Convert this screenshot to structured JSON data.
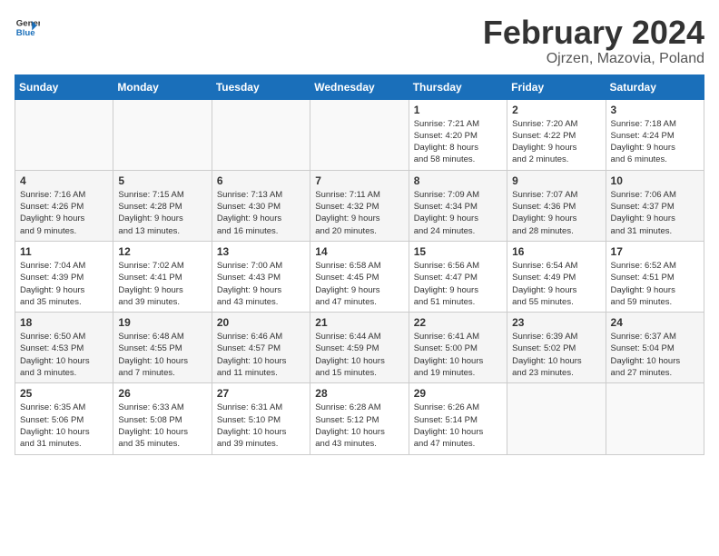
{
  "header": {
    "logo_line1": "General",
    "logo_line2": "Blue",
    "main_title": "February 2024",
    "subtitle": "Ojrzen, Mazovia, Poland"
  },
  "columns": [
    "Sunday",
    "Monday",
    "Tuesday",
    "Wednesday",
    "Thursday",
    "Friday",
    "Saturday"
  ],
  "weeks": [
    [
      {
        "day": "",
        "info": ""
      },
      {
        "day": "",
        "info": ""
      },
      {
        "day": "",
        "info": ""
      },
      {
        "day": "",
        "info": ""
      },
      {
        "day": "1",
        "info": "Sunrise: 7:21 AM\nSunset: 4:20 PM\nDaylight: 8 hours\nand 58 minutes."
      },
      {
        "day": "2",
        "info": "Sunrise: 7:20 AM\nSunset: 4:22 PM\nDaylight: 9 hours\nand 2 minutes."
      },
      {
        "day": "3",
        "info": "Sunrise: 7:18 AM\nSunset: 4:24 PM\nDaylight: 9 hours\nand 6 minutes."
      }
    ],
    [
      {
        "day": "4",
        "info": "Sunrise: 7:16 AM\nSunset: 4:26 PM\nDaylight: 9 hours\nand 9 minutes."
      },
      {
        "day": "5",
        "info": "Sunrise: 7:15 AM\nSunset: 4:28 PM\nDaylight: 9 hours\nand 13 minutes."
      },
      {
        "day": "6",
        "info": "Sunrise: 7:13 AM\nSunset: 4:30 PM\nDaylight: 9 hours\nand 16 minutes."
      },
      {
        "day": "7",
        "info": "Sunrise: 7:11 AM\nSunset: 4:32 PM\nDaylight: 9 hours\nand 20 minutes."
      },
      {
        "day": "8",
        "info": "Sunrise: 7:09 AM\nSunset: 4:34 PM\nDaylight: 9 hours\nand 24 minutes."
      },
      {
        "day": "9",
        "info": "Sunrise: 7:07 AM\nSunset: 4:36 PM\nDaylight: 9 hours\nand 28 minutes."
      },
      {
        "day": "10",
        "info": "Sunrise: 7:06 AM\nSunset: 4:37 PM\nDaylight: 9 hours\nand 31 minutes."
      }
    ],
    [
      {
        "day": "11",
        "info": "Sunrise: 7:04 AM\nSunset: 4:39 PM\nDaylight: 9 hours\nand 35 minutes."
      },
      {
        "day": "12",
        "info": "Sunrise: 7:02 AM\nSunset: 4:41 PM\nDaylight: 9 hours\nand 39 minutes."
      },
      {
        "day": "13",
        "info": "Sunrise: 7:00 AM\nSunset: 4:43 PM\nDaylight: 9 hours\nand 43 minutes."
      },
      {
        "day": "14",
        "info": "Sunrise: 6:58 AM\nSunset: 4:45 PM\nDaylight: 9 hours\nand 47 minutes."
      },
      {
        "day": "15",
        "info": "Sunrise: 6:56 AM\nSunset: 4:47 PM\nDaylight: 9 hours\nand 51 minutes."
      },
      {
        "day": "16",
        "info": "Sunrise: 6:54 AM\nSunset: 4:49 PM\nDaylight: 9 hours\nand 55 minutes."
      },
      {
        "day": "17",
        "info": "Sunrise: 6:52 AM\nSunset: 4:51 PM\nDaylight: 9 hours\nand 59 minutes."
      }
    ],
    [
      {
        "day": "18",
        "info": "Sunrise: 6:50 AM\nSunset: 4:53 PM\nDaylight: 10 hours\nand 3 minutes."
      },
      {
        "day": "19",
        "info": "Sunrise: 6:48 AM\nSunset: 4:55 PM\nDaylight: 10 hours\nand 7 minutes."
      },
      {
        "day": "20",
        "info": "Sunrise: 6:46 AM\nSunset: 4:57 PM\nDaylight: 10 hours\nand 11 minutes."
      },
      {
        "day": "21",
        "info": "Sunrise: 6:44 AM\nSunset: 4:59 PM\nDaylight: 10 hours\nand 15 minutes."
      },
      {
        "day": "22",
        "info": "Sunrise: 6:41 AM\nSunset: 5:00 PM\nDaylight: 10 hours\nand 19 minutes."
      },
      {
        "day": "23",
        "info": "Sunrise: 6:39 AM\nSunset: 5:02 PM\nDaylight: 10 hours\nand 23 minutes."
      },
      {
        "day": "24",
        "info": "Sunrise: 6:37 AM\nSunset: 5:04 PM\nDaylight: 10 hours\nand 27 minutes."
      }
    ],
    [
      {
        "day": "25",
        "info": "Sunrise: 6:35 AM\nSunset: 5:06 PM\nDaylight: 10 hours\nand 31 minutes."
      },
      {
        "day": "26",
        "info": "Sunrise: 6:33 AM\nSunset: 5:08 PM\nDaylight: 10 hours\nand 35 minutes."
      },
      {
        "day": "27",
        "info": "Sunrise: 6:31 AM\nSunset: 5:10 PM\nDaylight: 10 hours\nand 39 minutes."
      },
      {
        "day": "28",
        "info": "Sunrise: 6:28 AM\nSunset: 5:12 PM\nDaylight: 10 hours\nand 43 minutes."
      },
      {
        "day": "29",
        "info": "Sunrise: 6:26 AM\nSunset: 5:14 PM\nDaylight: 10 hours\nand 47 minutes."
      },
      {
        "day": "",
        "info": ""
      },
      {
        "day": "",
        "info": ""
      }
    ]
  ]
}
